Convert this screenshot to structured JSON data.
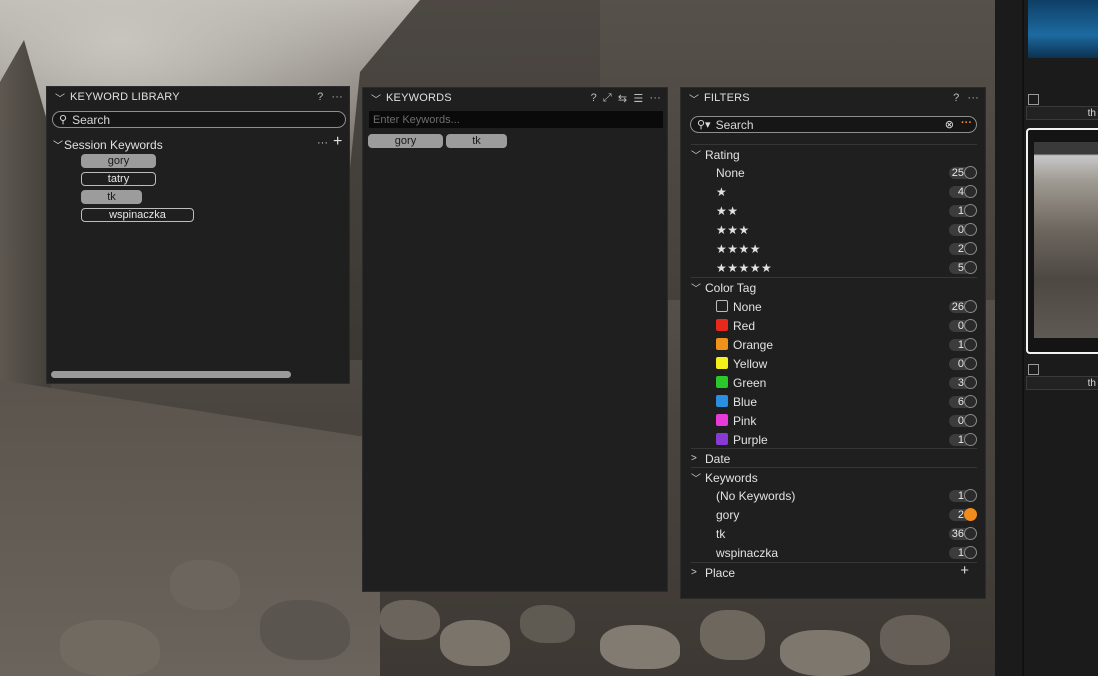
{
  "keyword_library": {
    "title": "KEYWORD LIBRARY",
    "help": "?",
    "more": "···",
    "search_placeholder": "Search",
    "session": {
      "label": "Session Keywords",
      "more": "···",
      "add": "+",
      "keywords": [
        {
          "label": "gory",
          "selected": true
        },
        {
          "label": "tatry",
          "selected": false
        },
        {
          "label": "tk",
          "selected": true
        },
        {
          "label": "wspinaczka",
          "selected": false
        }
      ]
    }
  },
  "keywords_panel": {
    "title": "KEYWORDS",
    "help": "?",
    "more": "···",
    "input_placeholder": "Enter Keywords...",
    "tags": [
      "gory",
      "tk"
    ]
  },
  "filters": {
    "title": "FILTERS",
    "help": "?",
    "more": "···",
    "search_placeholder": "Search",
    "rating": {
      "label": "Rating",
      "rows": [
        {
          "label": "None",
          "count": "25"
        },
        {
          "label": "★",
          "count": "4"
        },
        {
          "label": "★★",
          "count": "1"
        },
        {
          "label": "★★★",
          "count": "0"
        },
        {
          "label": "★★★★",
          "count": "2"
        },
        {
          "label": "★★★★★",
          "count": "5"
        }
      ]
    },
    "color_tag": {
      "label": "Color Tag",
      "rows": [
        {
          "label": "None",
          "count": "26",
          "color": "none"
        },
        {
          "label": "Red",
          "count": "0",
          "color": "#e8281c"
        },
        {
          "label": "Orange",
          "count": "1",
          "color": "#f0921a"
        },
        {
          "label": "Yellow",
          "count": "0",
          "color": "#f4f01c"
        },
        {
          "label": "Green",
          "count": "3",
          "color": "#2bc82b"
        },
        {
          "label": "Blue",
          "count": "6",
          "color": "#2a8fe0"
        },
        {
          "label": "Pink",
          "count": "0",
          "color": "#e83ad8"
        },
        {
          "label": "Purple",
          "count": "1",
          "color": "#8a3ad4"
        }
      ]
    },
    "date": {
      "label": "Date"
    },
    "keywords": {
      "label": "Keywords",
      "rows": [
        {
          "label": "(No Keywords)",
          "count": "1",
          "active": false
        },
        {
          "label": "gory",
          "count": "2",
          "active": true
        },
        {
          "label": "tk",
          "count": "36",
          "active": false
        },
        {
          "label": "wspinaczka",
          "count": "1",
          "active": false
        }
      ]
    },
    "place": {
      "label": "Place",
      "add": "+"
    }
  },
  "browser_strip": {
    "labels": [
      "th",
      "th"
    ]
  },
  "colors": {
    "panel_bg": "#1f1f1f",
    "toggle_active": "#f28b1d"
  }
}
